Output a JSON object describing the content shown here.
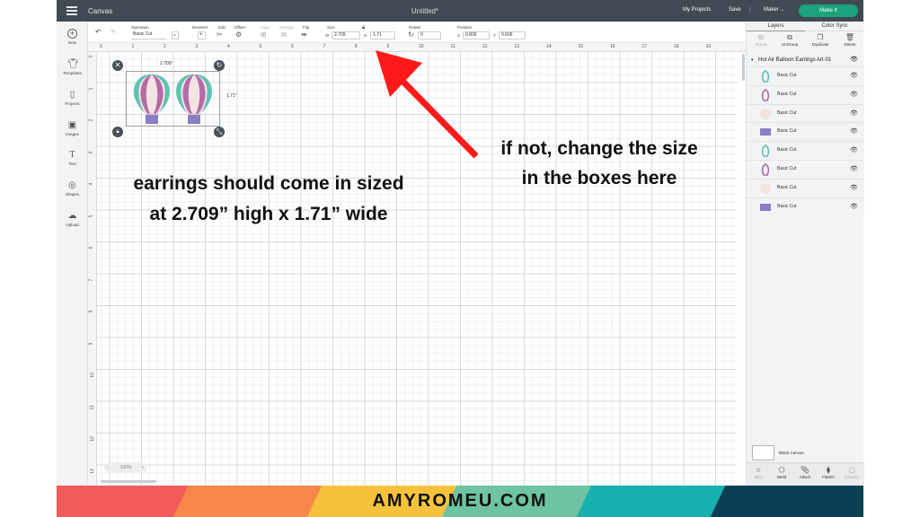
{
  "topbar": {
    "title": "Canvas",
    "document": "Untitled*",
    "my_projects": "My Projects",
    "save": "Save",
    "separator": "|",
    "machine": "Maker",
    "machine_chevron": "⌄",
    "make_it": "Make It"
  },
  "toolbar": {
    "undo": "↶",
    "redo": "↷",
    "operation_label": "Operation",
    "operation_value": "Basic Cut",
    "deselect_label": "Deselect",
    "edit_label": "Edit",
    "offset_label": "Offset",
    "align_label": "Align",
    "arrange_label": "Arrange",
    "flip_label": "Flip",
    "size_label": "Size",
    "w_label": "W",
    "w_value": "2.709",
    "h_label": "H",
    "h_value": "1.71",
    "rotate_label": "Rotate",
    "rotate_value": "0",
    "position_label": "Position",
    "x_label": "X",
    "x_value": "0.806",
    "y_label": "Y",
    "y_value": "0.606",
    "help": "?"
  },
  "sidebar": {
    "items": [
      {
        "label": "New",
        "icon": "plus-icon"
      },
      {
        "label": "Templates",
        "icon": "tshirt-icon"
      },
      {
        "label": "Projects",
        "icon": "projects-icon"
      },
      {
        "label": "Images",
        "icon": "image-icon"
      },
      {
        "label": "Text",
        "icon": "text-icon"
      },
      {
        "label": "Shapes",
        "icon": "shapes-icon"
      },
      {
        "label": "Upload",
        "icon": "upload-icon"
      }
    ]
  },
  "rulers": {
    "top": [
      "0",
      "1",
      "2",
      "3",
      "4",
      "5",
      "6",
      "7",
      "8",
      "9",
      "10",
      "11",
      "12",
      "13",
      "14",
      "15",
      "16",
      "17",
      "18",
      "19"
    ],
    "left": [
      "0",
      "1",
      "2",
      "3",
      "4",
      "5",
      "6",
      "7",
      "8",
      "9",
      "10",
      "11",
      "12",
      "13"
    ]
  },
  "selection": {
    "width_label": "2.709\"",
    "height_label": "1.71\""
  },
  "zoom": {
    "minus": "−",
    "value": "100%",
    "plus": "+"
  },
  "panel": {
    "tabs": [
      "Layers",
      "Color Sync"
    ],
    "actions": [
      "Group",
      "UnGroup",
      "Duplicate",
      "Delete"
    ],
    "group_name": "Hot Air Balloon Earrings Art-01",
    "layers": [
      {
        "name": "Basic Cut",
        "color": "#5cc4b0",
        "shape": "balloon-outline"
      },
      {
        "name": "Basic Cut",
        "color": "#b56aa6",
        "shape": "balloon-outline"
      },
      {
        "name": "Basic Cut",
        "color": "#f3e3e3",
        "shape": "circle"
      },
      {
        "name": "Basic Cut",
        "color": "#8a7ec4",
        "shape": "basket"
      },
      {
        "name": "Basic Cut",
        "color": "#5cc4b0",
        "shape": "balloon-outline"
      },
      {
        "name": "Basic Cut",
        "color": "#b56aa6",
        "shape": "balloon-outline"
      },
      {
        "name": "Basic Cut",
        "color": "#f3e3e3",
        "shape": "circle"
      },
      {
        "name": "Basic Cut",
        "color": "#8a7ec4",
        "shape": "basket"
      }
    ],
    "blank_canvas": "Blank Canvas",
    "bottom_actions": [
      "Slice",
      "Weld",
      "Attach",
      "Flatten",
      "Contour"
    ]
  },
  "annotations": {
    "left_line1": "earrings should come in sized",
    "left_line2": "at 2.709” high x 1.71” wide",
    "right_line1": "if not, change the size",
    "right_line2": "in the boxes here",
    "arrow_color": "#ff1a1a"
  },
  "footer": {
    "text": "AMYROMEU.COM",
    "colors": [
      "#f15b5b",
      "#f7864a",
      "#f6c23e",
      "#6ec3a0",
      "#17b1b0",
      "#0b3f54"
    ]
  },
  "colors": {
    "accent": "#1aa37c",
    "topbar": "#414a52"
  }
}
